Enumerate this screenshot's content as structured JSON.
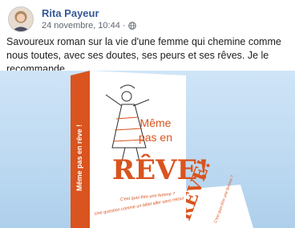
{
  "post": {
    "author": "Rita Payeur",
    "date": "24 novembre, 10:44",
    "separator": "·",
    "audience_icon": "globe-icon",
    "text": "Savoureux roman sur la vie d'une femme qui chemine comme nous toutes, avec ses doutes, ses peurs et ses rêves. Je le recommande."
  },
  "photo": {
    "book_spine_title": "Même pas en rêve !",
    "book_title_line1": "Même",
    "book_title_line2": "pas en",
    "book_title_line3": "RÊVE!",
    "book_tagline_line1": "C'est quoi être une femme ?",
    "book_tagline_line2": "Une question comme un billet aller sans retour",
    "second_book_title": "RÊVE!",
    "second_book_tagline": "C'est quoi être une femme ?"
  },
  "colors": {
    "accent": "#d9541e",
    "link": "#365899",
    "meta": "#606770",
    "background_photo": "#bcd9f1"
  }
}
